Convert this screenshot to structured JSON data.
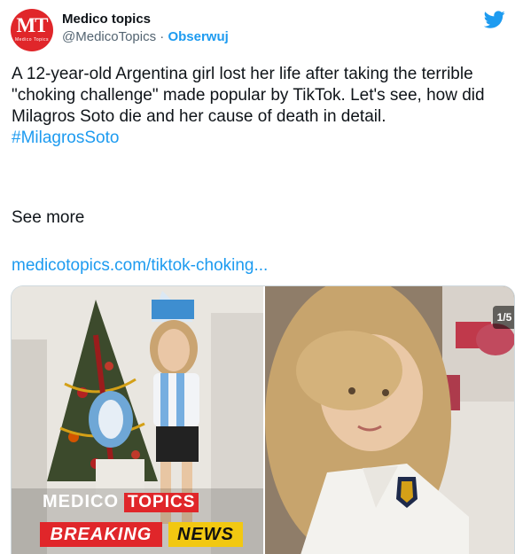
{
  "author": {
    "avatar_text": "MT",
    "avatar_subtext": "Medico Topics",
    "display_name": "Medico topics",
    "handle": "@MedicoTopics",
    "separator": " · ",
    "follow_label": "Obserwuj"
  },
  "tweet": {
    "body": "A 12-year-old Argentina girl lost her life after taking the terrible \"choking challenge\" made popular by TikTok. Let's see, how did Milagros Soto die and her cause of death in detail.",
    "hashtag": "#MilagrosSoto",
    "see_more": "See more",
    "link": "medicotopics.com/tiktok-choking..."
  },
  "media": {
    "left_overlay": {
      "brand_word_1": "MEDICO",
      "brand_word_2": "TOPICS",
      "breaking": "BREAKING",
      "news": "NEWS"
    },
    "counter": "1/5"
  },
  "colors": {
    "accent": "#1d9bf0",
    "brand_red": "#e0262a",
    "news_yellow": "#f2c811",
    "text": "#0f1419",
    "muted": "#536471"
  },
  "icons": {
    "logo": "twitter-bird-icon"
  }
}
